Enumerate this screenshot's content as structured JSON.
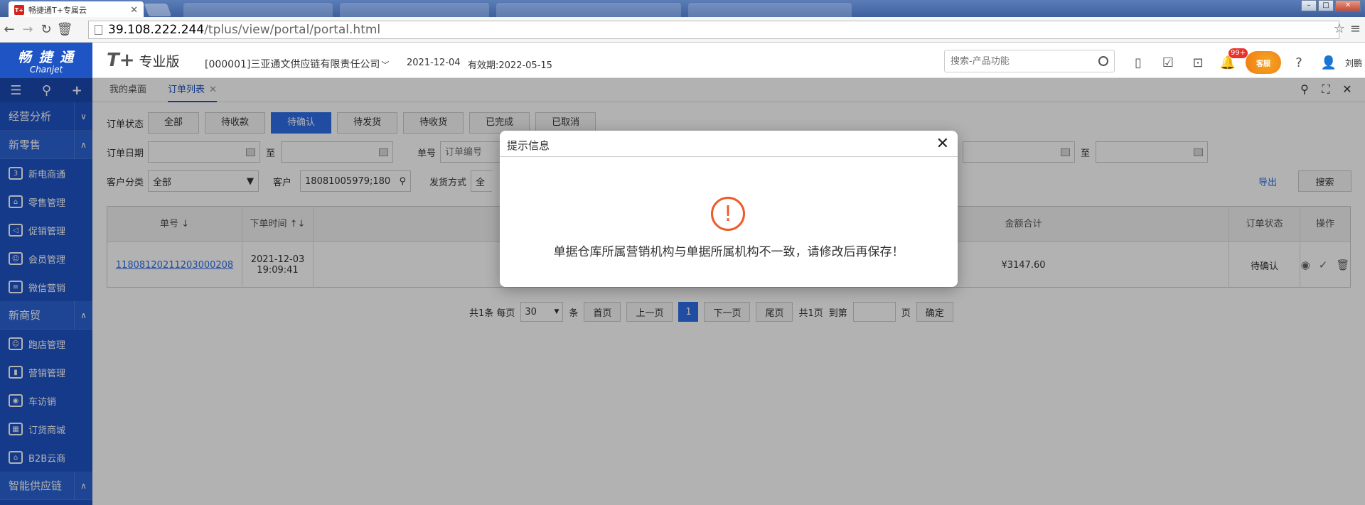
{
  "browser": {
    "tab_title": "畅捷通T+专属云",
    "tab_favicon": "T+",
    "url_host": "39.108.222.244",
    "url_path": "/tplus/view/portal/portal.html"
  },
  "header": {
    "brand_cn": "畅 捷 通",
    "brand_en": "Chanjet",
    "product_logo": "T+",
    "product_name": "专业版",
    "company": "[000001]三亚通文供应链有限责任公司",
    "date": "2021-12-04",
    "validity": "有效期:2022-05-15",
    "search_placeholder": "搜索-产品功能",
    "badge": "99+",
    "service": "客服",
    "user": "刘鹏"
  },
  "sidebar": {
    "groups": [
      {
        "label": "经营分析"
      },
      {
        "label": "新零售"
      },
      {
        "label": "新商贸"
      },
      {
        "label": "智能供应链"
      }
    ],
    "retail_items": [
      {
        "label": "新电商通"
      },
      {
        "label": "零售管理"
      },
      {
        "label": "促销管理"
      },
      {
        "label": "会员管理"
      },
      {
        "label": "微信营销"
      }
    ],
    "trade_items": [
      {
        "label": "跑店管理"
      },
      {
        "label": "营销管理"
      },
      {
        "label": "车访销"
      },
      {
        "label": "订货商城"
      },
      {
        "label": "B2B云商"
      }
    ]
  },
  "tabs": {
    "desktop": "我的桌面",
    "orders": "订单列表"
  },
  "filters": {
    "status_label": "订单状态",
    "status_options": [
      "全部",
      "待收款",
      "待确认",
      "待发货",
      "待收货",
      "已完成",
      "已取消"
    ],
    "date_label": "订单日期",
    "to": "至",
    "order_no_label": "单号",
    "order_no_placeholder": "订单编号",
    "category_label": "客户分类",
    "category_value": "全部",
    "customer_label": "客户",
    "customer_value": "18081005979;180",
    "ship_label": "发货方式",
    "ship_value": "全",
    "export": "导出",
    "search": "搜索"
  },
  "table": {
    "headers": {
      "order_no": "单号 ↓",
      "order_time": "下单时间 ↑↓",
      "amount": "金额合计",
      "status": "订单状态",
      "ops": "操作"
    },
    "rows": [
      {
        "order_no": "11808120211203000208",
        "date": "2021-12-03",
        "time": "19:09:41",
        "amount": "¥3147.60",
        "status": "待确认"
      }
    ]
  },
  "pager": {
    "total": "共1条 每页",
    "page_size": "30",
    "unit": "条",
    "first": "首页",
    "prev": "上一页",
    "current": "1",
    "next": "下一页",
    "last": "尾页",
    "pages": "共1页",
    "goto": "到第",
    "page": "页",
    "confirm": "确定"
  },
  "dialog": {
    "title": "提示信息",
    "message": "单据仓库所属营销机构与单据所属机构不一致，请修改后再保存！"
  },
  "colors": {
    "brand": "#1f54c4",
    "accent": "#2e6ee8",
    "warning": "#f05a28"
  }
}
